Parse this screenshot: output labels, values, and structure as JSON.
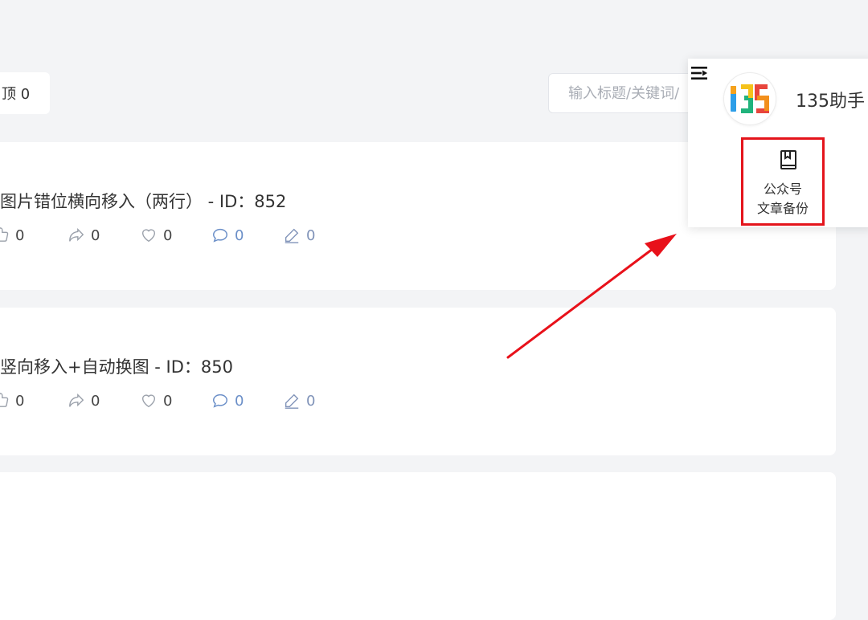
{
  "toolbar": {
    "pin_label": "顶 0",
    "search_placeholder": "输入标题/关键词/"
  },
  "cards": [
    {
      "title": "图片错位横向移入（两行） - ID：852",
      "likes": "0",
      "shares": "0",
      "favorites": "0",
      "comments": "0",
      "edits": "0"
    },
    {
      "title": "竖向移入+自动换图 - ID：850",
      "likes": "0",
      "shares": "0",
      "favorites": "0",
      "comments": "0",
      "edits": "0"
    }
  ],
  "popup": {
    "app_name": "135助手",
    "backup_line1": "公众号",
    "backup_line2": "文章备份"
  },
  "colors": {
    "highlight": "#e4141b",
    "arrow": "#e8111a",
    "comment_blue": "#6b8fc8"
  }
}
